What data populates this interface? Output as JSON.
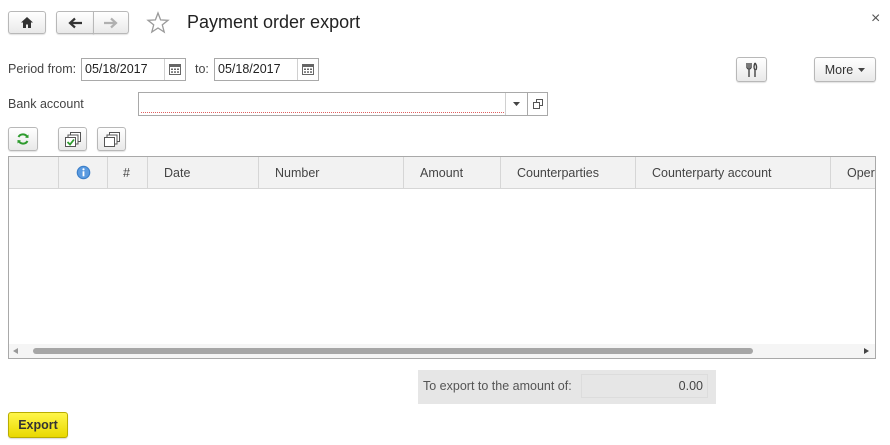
{
  "header": {
    "title": "Payment order export",
    "close_symbol": "×"
  },
  "filters": {
    "period_from_label": "Period from:",
    "period_from_value": "05/18/2017",
    "to_label": "to:",
    "to_value": "05/18/2017",
    "bank_account_label": "Bank account",
    "bank_account_value": ""
  },
  "toolbar": {
    "more_label": "More"
  },
  "table": {
    "columns": [
      "",
      "",
      "#",
      "Date",
      "Number",
      "Amount",
      "Counterparties",
      "Counterparty account",
      "Oper"
    ],
    "rows": []
  },
  "summary": {
    "label": "To export to the amount of:",
    "value": "0.00"
  },
  "actions": {
    "export_label": "Export"
  },
  "colors": {
    "export_button": "#f3e51a",
    "required_underline": "#e06060",
    "info_icon": "#3c7fc9",
    "refresh_icon": "#2e9b2e"
  }
}
